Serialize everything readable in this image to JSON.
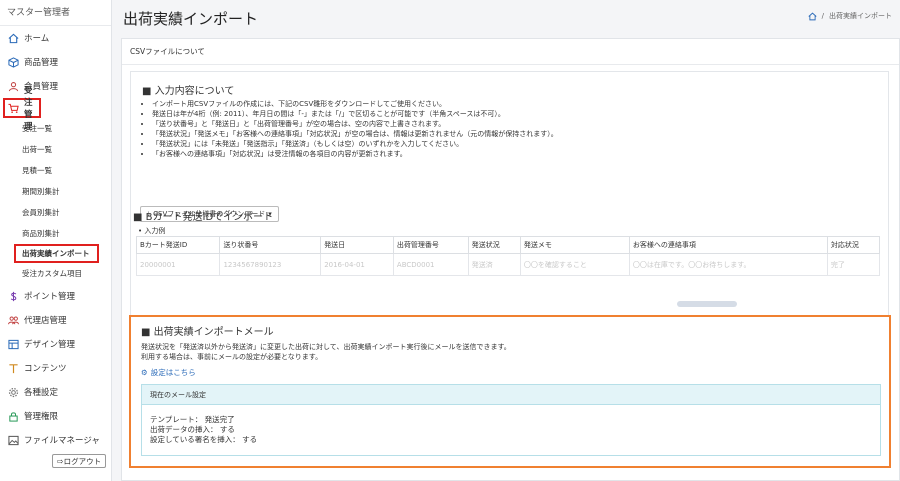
{
  "sidebar": {
    "role": "マスター管理者",
    "items": [
      {
        "label": "ホーム",
        "icon": "home-icon"
      },
      {
        "label": "商品管理",
        "icon": "box-icon"
      },
      {
        "label": "会員管理",
        "icon": "user-icon"
      },
      {
        "label": "受注管理",
        "icon": "cart-icon"
      }
    ],
    "order_sub": [
      "受注一覧",
      "出荷一覧",
      "見積一覧",
      "期間別集計",
      "会員別集計",
      "商品別集計",
      "出荷実績インポート",
      "受注カスタム項目"
    ],
    "items_after": [
      {
        "label": "ポイント管理",
        "icon": "dollar-icon"
      },
      {
        "label": "代理店管理",
        "icon": "users-icon"
      },
      {
        "label": "デザイン管理",
        "icon": "layout-icon"
      },
      {
        "label": "コンテンツ",
        "icon": "text-icon"
      },
      {
        "label": "各種設定",
        "icon": "gear-icon"
      },
      {
        "label": "管理権限",
        "icon": "lock-icon"
      },
      {
        "label": "ファイルマネージャ",
        "icon": "image-icon"
      }
    ],
    "logout": "ログアウト"
  },
  "header": {
    "title": "出荷実績インポート",
    "breadcrumb": "出荷実績インポート"
  },
  "main": {
    "card_title": "CSVファイルについて",
    "input_title": "入力内容について",
    "bullets": [
      "インポート用CSVファイルの作成には、下記のCSV雛形をダウンロードしてご使用ください。",
      "発送日は年が4桁（例: 2011）、年月日の間は「-」または「/」で区切ることが可能です（半角スペースは不可）。",
      "「送り状番号」と「発送日」と「出荷管理番号」が空の場合は、空の内容で上書きされます。",
      "「発送状況」「発送メモ」「お客様への連絡事項」「対応状況」が空の場合は、情報は更新されません（元の情報が保持されます）。",
      "「発送状況」には「未発送」「発送指示」「発送済」（もしくは空）のいずれかを入力してください。",
      "「お客様への連絡事項」「対応状況」は受注情報の各項目の内容が更新されます。"
    ],
    "download_btn": "CSVファイル仕様書のダウンロード",
    "import_title": "Bカート発送IDでインポート",
    "example_label": "入力例",
    "table_headers": [
      "Bカート発送ID",
      "送り状番号",
      "発送日",
      "出荷管理番号",
      "発送状況",
      "発送メモ",
      "お客様への連絡事項",
      "対応状況"
    ],
    "table_row": [
      "20000001",
      "1234567890123",
      "2016-04-01",
      "ABCD0001",
      "発送済",
      "〇〇を確認すること",
      "〇〇は在庫です。〇〇お待ちします。",
      "完了"
    ]
  },
  "mail": {
    "title": "出荷実績インポートメール",
    "desc1": "発送状況を「発送済以外から発送済」に変更した出荷に対して、出荷実績インポート実行後にメールを送信できます。",
    "desc2": "利用する場合は、事前にメールの設定が必要となります。",
    "settings_link": "設定はこちら",
    "box_title": "現在のメール設定",
    "template_line": "テンプレート： 発送完了",
    "data_line": "出荷データの挿入： する",
    "sign_line": "設定している署名を挿入： する"
  }
}
